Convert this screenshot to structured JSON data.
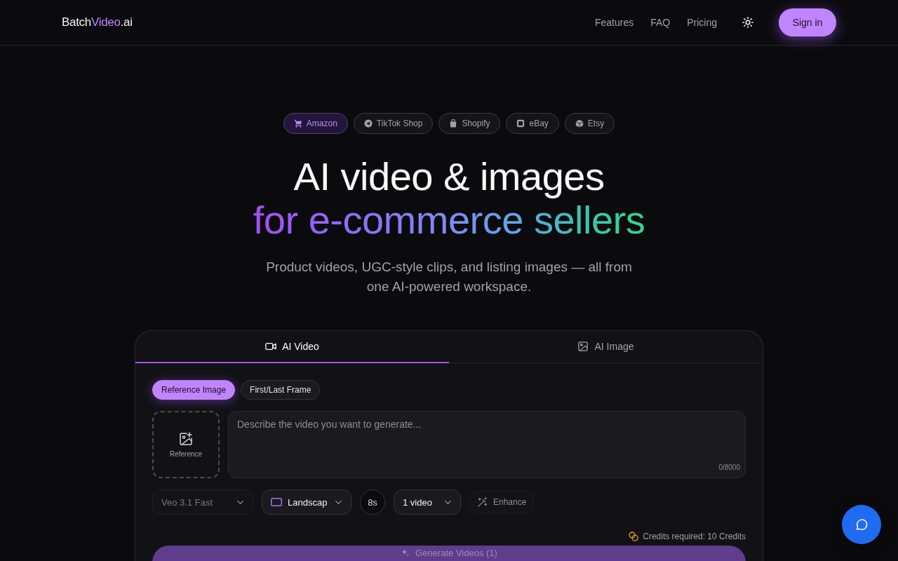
{
  "header": {
    "logo": [
      {
        "text": "Batch",
        "accent": false
      },
      {
        "text": "Video",
        "accent": true
      },
      {
        "text": ".ai",
        "accent": false
      }
    ],
    "nav": [
      "Features",
      "FAQ",
      "Pricing"
    ],
    "sign_in": "Sign in"
  },
  "platforms": [
    {
      "label": "Amazon",
      "selected": true
    },
    {
      "label": "TikTok Shop",
      "selected": false
    },
    {
      "label": "Shopify",
      "selected": false
    },
    {
      "label": "eBay",
      "selected": false
    },
    {
      "label": "Etsy",
      "selected": false
    }
  ],
  "hero": {
    "title": "AI video & images",
    "title_highlight": "for e-commerce sellers",
    "subtitle": "Product videos, UGC-style clips, and listing images — all from one AI-powered workspace."
  },
  "generator": {
    "tabs": [
      {
        "label": "AI Video",
        "selected": true
      },
      {
        "label": "AI Image",
        "selected": false
      }
    ],
    "modes": [
      {
        "label": "Reference Image",
        "selected": true
      },
      {
        "label": "First/Last Frame",
        "selected": false
      }
    ],
    "upload": {
      "label": "Reference"
    },
    "prompt": {
      "placeholder": "Describe the video you want to generate...",
      "counter": "0/8000"
    },
    "options": [
      {
        "kind": "model",
        "label": "Veo 3.1 Fast",
        "disabled": true
      },
      {
        "kind": "aspect",
        "label": "Landscap",
        "disabled": false
      },
      {
        "kind": "duration",
        "label": "8s",
        "disabled": false
      },
      {
        "kind": "count",
        "label": "1 video",
        "disabled": false
      },
      {
        "kind": "enhance",
        "label": "Enhance",
        "disabled": true
      }
    ],
    "credits": "Credits required: 10 Credits",
    "generate": {
      "label": "Generate Videos (1)",
      "disabled": true
    }
  }
}
